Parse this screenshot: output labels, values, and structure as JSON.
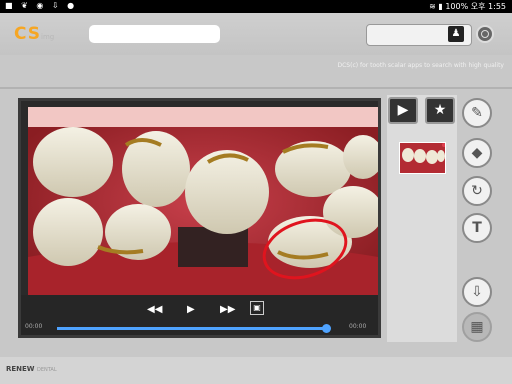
{
  "status_bar": {
    "left_icons": "■ ❦ ◉ ⇩ ●",
    "battery": "100%",
    "ampm": "오후",
    "time": "1:55"
  },
  "header": {
    "logo": "CS",
    "logo_sub": "img",
    "notice": "DCS(c) for tooth scalar apps to search with high quality"
  },
  "icons": {
    "person": "person-icon",
    "target": "target-icon",
    "video_mode": "video-camera-icon",
    "star_mode": "star-icon",
    "pen": "pen-icon",
    "eraser": "eraser-icon",
    "rotate": "rotate-icon",
    "text": "text-icon",
    "download": "download-icon",
    "gallery": "gallery-icon"
  },
  "player": {
    "rewind": "◀◀",
    "play": "▶",
    "forward": "▶▶",
    "time_current": "00:00",
    "time_total": "00:00",
    "progress": 1.0
  },
  "tools": {
    "text_label": "T"
  },
  "footer": {
    "brand": "RENEW",
    "brand_sub": "DENTAL"
  },
  "colors": {
    "accent": "#4fa3ff",
    "annotation": "#e0141e",
    "logo": "#f6a623"
  }
}
